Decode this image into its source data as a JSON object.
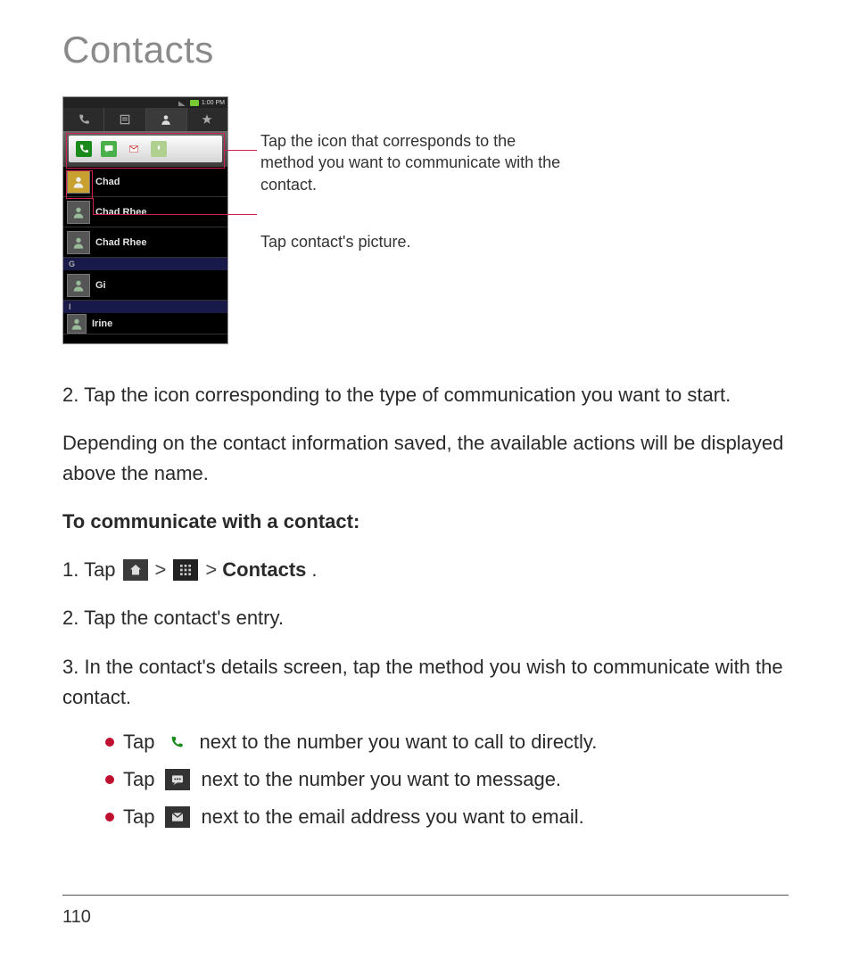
{
  "page_title": "Contacts",
  "page_number": "110",
  "screenshot": {
    "status_time": "1:00 PM",
    "tabs": [
      "dial",
      "log",
      "contacts",
      "favorites"
    ],
    "quick_actions": [
      "phone",
      "sms",
      "gmail",
      "other"
    ],
    "section_dividers": [
      "G",
      "I"
    ],
    "contacts": [
      "Chad",
      "Chad Rhee",
      "Chad Rhee",
      "Gi",
      "Irine"
    ]
  },
  "callouts": {
    "quick_bar": "Tap the icon that corresponds to the method you want to communicate with the contact.",
    "avatar": "Tap contact's picture."
  },
  "body": {
    "step2": "2. Tap the icon corresponding to the type of communication you want to start.",
    "depending": "Depending on the contact information saved, the available actions will be displayed above the name.",
    "heading": "To communicate with a contact:",
    "s1_prefix": "1. Tap",
    "s1_gt1": ">",
    "s1_gt2": ">",
    "s1_contacts": "Contacts",
    "s1_period": ".",
    "s2": "2. Tap the contact's entry.",
    "s3": "3. In the contact's details screen, tap the method you wish to communicate with the contact.",
    "b1_prefix": "Tap",
    "b1_suffix": "next to the number you want to call to directly.",
    "b2_prefix": "Tap",
    "b2_suffix": "next to the number you want to message.",
    "b3_prefix": "Tap",
    "b3_suffix": "next to the email address you want to email."
  }
}
